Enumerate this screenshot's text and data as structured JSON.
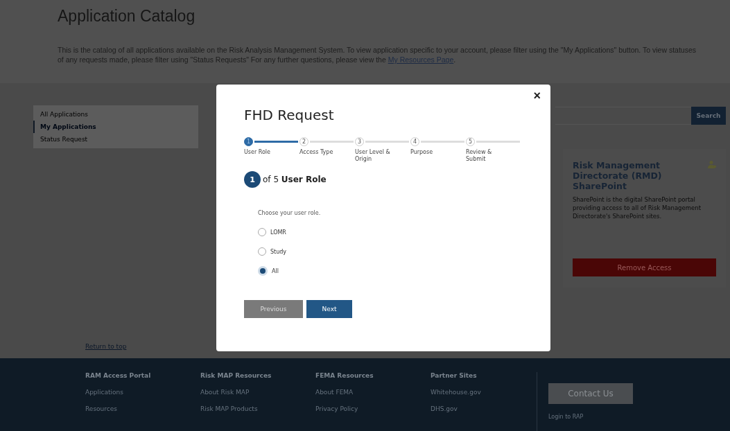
{
  "page": {
    "title": "Application Catalog",
    "intro": "This is the catalog of all applications available on the Risk Analysis Management System. To view application specific to your account, please filter using the \"My Applications\" button. To view statuses of any requests made, please filter using \"Status Requests\" For any further questions, please view the",
    "intro_link": "My Resources Page",
    "intro_end": "."
  },
  "sidebar": {
    "items": [
      {
        "label": "All Applications",
        "selected": false
      },
      {
        "label": "My Applications",
        "selected": true
      },
      {
        "label": "Status Request",
        "selected": false
      }
    ]
  },
  "search": {
    "button": "Search"
  },
  "card": {
    "title": "Risk Management Directorate (RMD) SharePoint",
    "description": "SharePoint is the digital SharePoint portal providing access to all of Risk Management Directorate's SharePoint sites.",
    "button": "Remove Access"
  },
  "return_link": "Return to top",
  "footer": {
    "columns": [
      {
        "heading": "RAM Access Portal",
        "links": [
          "Applications",
          "Resources"
        ]
      },
      {
        "heading": "Risk MAP Resources",
        "links": [
          "About Risk MAP",
          "Risk MAP Products"
        ]
      },
      {
        "heading": "FEMA Resources",
        "links": [
          "About FEMA",
          "Privacy Policy"
        ]
      },
      {
        "heading": "Partner Sites",
        "links": [
          "Whitehouse.gov",
          "DHS.gov"
        ]
      }
    ],
    "contact_button": "Contact Us",
    "login_link": "Login to RAP"
  },
  "modal": {
    "title": "FHD Request",
    "close": "×",
    "steps": [
      {
        "number": "1",
        "label": "User Role",
        "selected": true
      },
      {
        "number": "2",
        "label": "Access Type",
        "selected": false
      },
      {
        "number": "3",
        "label": "User Level & Origin",
        "selected": false
      },
      {
        "number": "4",
        "label": "Purpose",
        "selected": false
      },
      {
        "number": "5",
        "label": "Review & Submit",
        "selected": false
      }
    ],
    "step_badge": "1",
    "step_heading": "of 5 **User Role**",
    "prompt": "Choose your user role.",
    "options": [
      {
        "label": "LOMR",
        "selected": false
      },
      {
        "label": "Study",
        "selected": false
      },
      {
        "label": "All",
        "selected": true
      }
    ],
    "buttons": [
      {
        "label": "Previous",
        "kind": "secondary"
      },
      {
        "label": "Next",
        "kind": "primary"
      }
    ]
  }
}
